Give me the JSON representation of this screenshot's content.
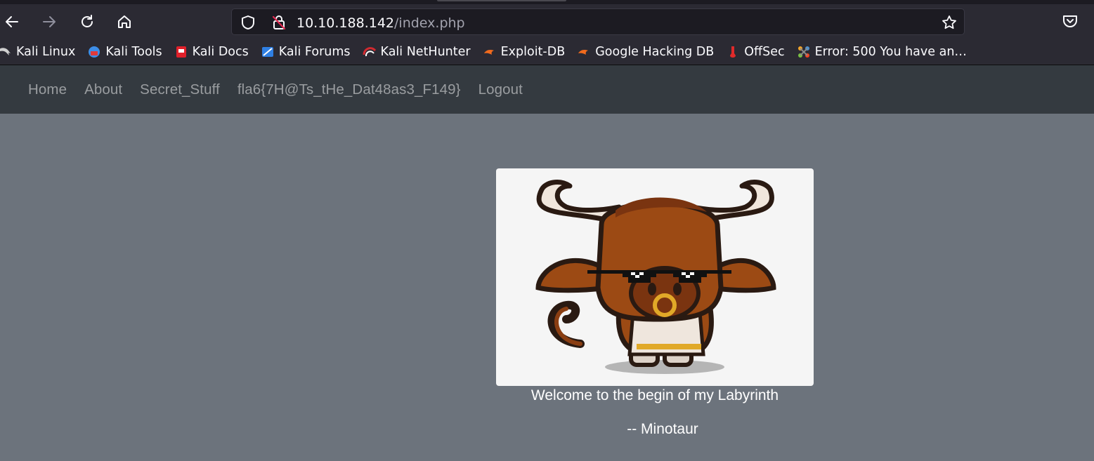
{
  "browser": {
    "url_host": "10.10.188.142",
    "url_path": "/index.php",
    "icons": {
      "back": "arrow-left-icon",
      "forward": "arrow-right-icon",
      "reload": "reload-icon",
      "home": "home-icon",
      "site_info": "shield-icon",
      "insecure": "lock-strikethrough-icon",
      "bookmark_star": "star-icon",
      "pocket": "pocket-icon"
    },
    "bookmarks": [
      {
        "label": "Kali Linux",
        "icon": "kali-dragon-icon",
        "color": "#d0d0d0"
      },
      {
        "label": "Kali Tools",
        "icon": "kali-tools-icon",
        "color": "#3d8ee8"
      },
      {
        "label": "Kali Docs",
        "icon": "kali-docs-icon",
        "color": "#e0202a"
      },
      {
        "label": "Kali Forums",
        "icon": "kali-forums-icon",
        "color": "#2f7fe3"
      },
      {
        "label": "Kali NetHunter",
        "icon": "nethunter-icon",
        "color": "#d02a30"
      },
      {
        "label": "Exploit-DB",
        "icon": "exploit-db-icon",
        "color": "#f06a1d"
      },
      {
        "label": "Google Hacking DB",
        "icon": "ghdb-icon",
        "color": "#f06a1d"
      },
      {
        "label": "OffSec",
        "icon": "offsec-icon",
        "color": "#e02a2a"
      },
      {
        "label": "Error: 500 You have an…",
        "icon": "joomla-icon",
        "color": "#f4a62a"
      }
    ]
  },
  "site": {
    "nav": [
      "Home",
      "About",
      "Secret_Stuff",
      "fla6{7H@Ts_tHe_Dat48as3_F149}",
      "Logout"
    ],
    "image": "minotaur-mascot-with-sunglasses",
    "caption": "Welcome to the begin of my Labyrinth",
    "signature": "-- Minotaur"
  },
  "colors": {
    "page_bg": "#6c737c",
    "navbar_bg": "#343a40",
    "nav_link": "#9a9da0",
    "chrome_bg": "#2b2a33"
  }
}
